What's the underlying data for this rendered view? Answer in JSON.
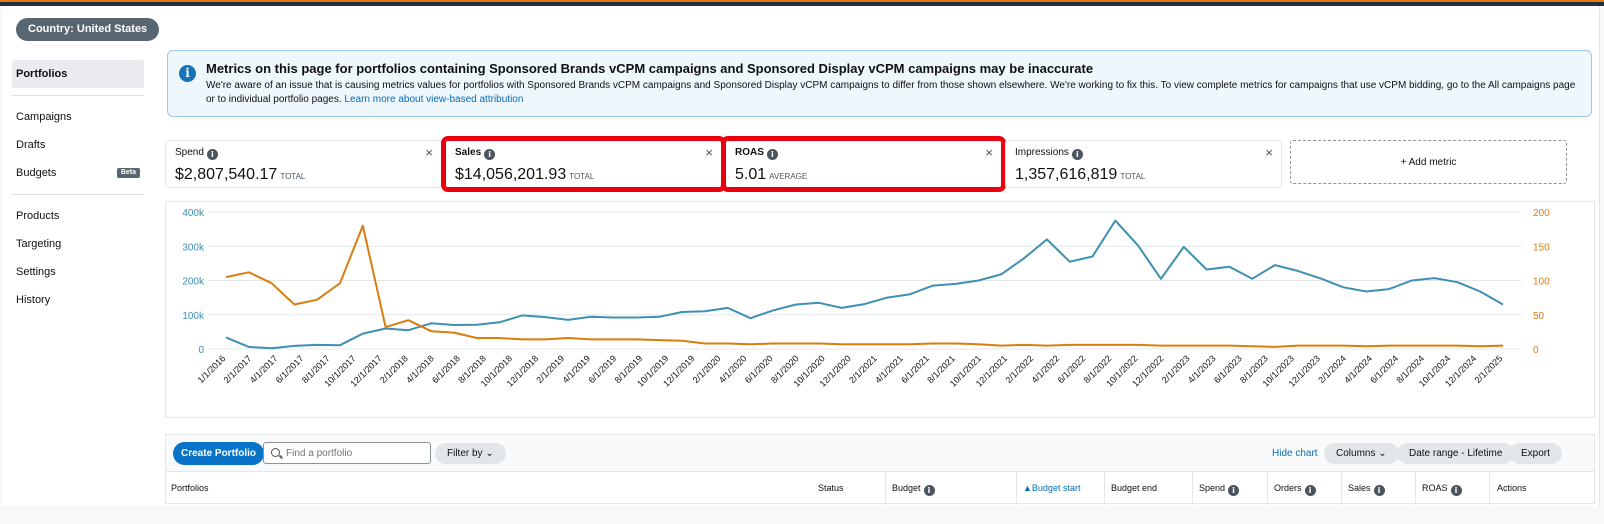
{
  "country": "Country: United States",
  "sidebar": {
    "items": [
      {
        "label": "Portfolios"
      },
      {
        "label": "Campaigns"
      },
      {
        "label": "Drafts"
      },
      {
        "label": "Budgets",
        "badge": "Beta"
      },
      {
        "label": "Products"
      },
      {
        "label": "Targeting"
      },
      {
        "label": "Settings"
      },
      {
        "label": "History"
      }
    ]
  },
  "banner": {
    "title": "Metrics on this page for portfolios containing Sponsored Brands vCPM campaigns and Sponsored Display vCPM campaigns may be inaccurate",
    "text": "We're aware of an issue that is causing metrics values for portfolios with Sponsored Brands vCPM campaigns and Sponsored Display vCPM campaigns to differ from those shown elsewhere. We're working to fix this. To view complete metrics for campaigns that use vCPM bidding, go to the All campaigns page or to individual portfolio pages.",
    "link": "Learn more about view-based attribution"
  },
  "metrics": [
    {
      "label": "Spend",
      "value": "$2,807,540.17",
      "unit": "TOTAL"
    },
    {
      "label": "Sales",
      "value": "$14,056,201.93",
      "unit": "TOTAL"
    },
    {
      "label": "ROAS",
      "value": "5.01",
      "unit": "AVERAGE"
    },
    {
      "label": "Impressions",
      "value": "1,357,616,819",
      "unit": "TOTAL"
    }
  ],
  "add_metric": "+ Add metric",
  "colors": {
    "accent": "#0973c8",
    "highlight": "#e8000d",
    "series_blue": "#3d8fb4",
    "series_orange": "#d97d0f"
  },
  "chart_data": {
    "type": "line",
    "x": [
      "1/1/2016",
      "2/1/2017",
      "4/1/2017",
      "6/1/2017",
      "8/1/2017",
      "10/1/2017",
      "12/1/2017",
      "2/1/2018",
      "4/1/2018",
      "6/1/2018",
      "8/1/2018",
      "10/1/2018",
      "12/1/2018",
      "2/1/2019",
      "4/1/2019",
      "6/1/2019",
      "8/1/2019",
      "10/1/2019",
      "12/1/2019",
      "2/1/2020",
      "4/1/2020",
      "6/1/2020",
      "8/1/2020",
      "10/1/2020",
      "12/1/2020",
      "2/1/2021",
      "4/1/2021",
      "6/1/2021",
      "8/1/2021",
      "10/1/2021",
      "12/1/2021",
      "2/1/2022",
      "4/1/2022",
      "6/1/2022",
      "8/1/2022",
      "10/1/2022",
      "12/1/2022",
      "2/1/2023",
      "4/1/2023",
      "6/1/2023",
      "8/1/2023",
      "10/1/2023",
      "12/1/2023",
      "2/1/2024",
      "4/1/2024",
      "6/1/2024",
      "8/1/2024",
      "10/1/2024",
      "12/1/2024",
      "2/1/2025"
    ],
    "y_left_ticks": [
      "0",
      "100k",
      "200k",
      "300k",
      "400k"
    ],
    "y_right_ticks": [
      "0",
      "50",
      "100",
      "150",
      "200"
    ],
    "ylim_left": [
      0,
      400000
    ],
    "ylim_right": [
      0,
      200
    ],
    "series": [
      {
        "axis": "left",
        "values": [
          34000,
          6000,
          2000,
          9000,
          12000,
          11000,
          45000,
          60000,
          55000,
          75000,
          70000,
          71000,
          78000,
          98000,
          93000,
          85000,
          94000,
          92000,
          92000,
          94000,
          108000,
          110000,
          120000,
          90000,
          113000,
          130000,
          135000,
          120000,
          131000,
          150000,
          160000,
          185000,
          190000,
          200000,
          218000,
          265000,
          320000,
          255000,
          270000,
          375000,
          302000,
          205000,
          298000,
          232000,
          240000,
          205000,
          245000,
          228000,
          206000,
          180000,
          168000,
          175000,
          200000,
          207000,
          195000,
          168000,
          130000
        ]
      },
      {
        "axis": "right",
        "values": [
          105,
          112,
          96,
          65,
          72,
          96,
          180,
          32,
          42,
          26,
          24,
          16,
          16,
          14,
          14,
          16,
          14,
          14,
          14,
          13,
          12,
          8,
          8,
          7,
          8,
          8,
          8,
          7,
          7,
          7,
          7,
          8,
          8,
          7,
          5,
          6,
          5,
          6,
          6,
          6,
          6,
          5,
          5,
          5,
          5,
          4,
          3,
          5,
          5,
          5,
          4,
          5,
          5,
          5,
          5,
          4,
          5
        ]
      }
    ]
  },
  "toolbar": {
    "create": "Create Portfolio",
    "search_placeholder": "Find a portfolio",
    "filter": "Filter by",
    "hide_chart": "Hide chart",
    "columns": "Columns",
    "date_range": "Date range - Lifetime",
    "export": "Export"
  },
  "table": {
    "headers": [
      "Portfolios",
      "Status",
      "Budget",
      "Budget start",
      "Budget end",
      "Spend",
      "Orders",
      "Sales",
      "ROAS",
      "Actions"
    ]
  }
}
